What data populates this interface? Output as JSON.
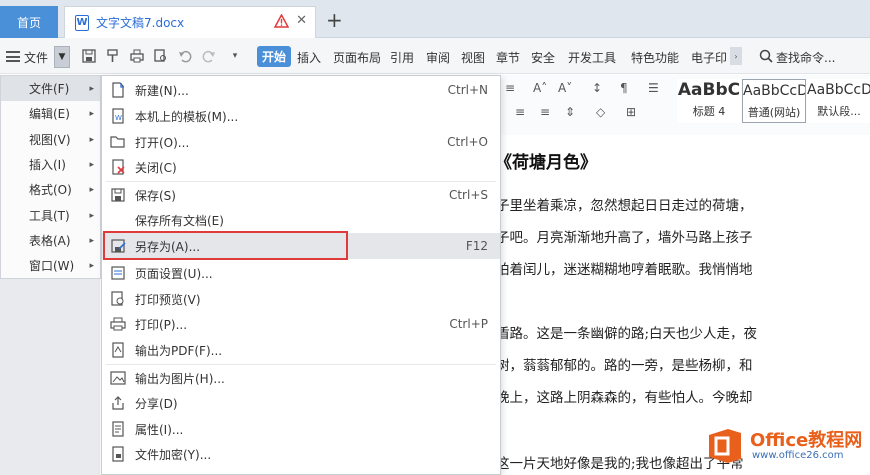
{
  "tabbar": {
    "home_tab": "首页",
    "doc_tab_title": "文字文稿7.docx",
    "doc_icon_letter": "W",
    "close_glyph": "✕",
    "add_glyph": "+"
  },
  "toolbar": {
    "file_menu_label": "文件",
    "ribbon_tabs": [
      "开始",
      "插入",
      "页面布局",
      "引用",
      "审阅",
      "视图",
      "章节",
      "安全",
      "开发工具",
      "特色功能",
      "电子印"
    ],
    "search_label": "查找命令..."
  },
  "styles": [
    {
      "sample": "AaBbC",
      "name": "标题 4"
    },
    {
      "sample": "AaBbCcDd",
      "name": "普通(网站)"
    },
    {
      "sample": "AaBbCcDd",
      "name": "默认段..."
    }
  ],
  "main_menu": [
    {
      "label": "文件(F)"
    },
    {
      "label": "编辑(E)"
    },
    {
      "label": "视图(V)"
    },
    {
      "label": "插入(I)"
    },
    {
      "label": "格式(O)"
    },
    {
      "label": "工具(T)"
    },
    {
      "label": "表格(A)"
    },
    {
      "label": "窗口(W)"
    }
  ],
  "file_submenu": [
    {
      "label": "新建(N)...",
      "shortcut": "Ctrl+N",
      "icon": "new-doc-icon"
    },
    {
      "label": "本机上的模板(M)...",
      "shortcut": "",
      "icon": "template-icon"
    },
    {
      "label": "打开(O)...",
      "shortcut": "Ctrl+O",
      "icon": "folder-open-icon"
    },
    {
      "label": "关闭(C)",
      "shortcut": "",
      "icon": "close-doc-icon"
    },
    {
      "label": "保存(S)",
      "shortcut": "Ctrl+S",
      "icon": "save-icon"
    },
    {
      "label": "保存所有文档(E)",
      "shortcut": "",
      "icon": ""
    },
    {
      "label": "另存为(A)...",
      "shortcut": "F12",
      "icon": "save-as-icon"
    },
    {
      "label": "页面设置(U)...",
      "shortcut": "",
      "icon": "page-setup-icon"
    },
    {
      "label": "打印预览(V)",
      "shortcut": "",
      "icon": "print-preview-icon"
    },
    {
      "label": "打印(P)...",
      "shortcut": "Ctrl+P",
      "icon": "print-icon"
    },
    {
      "label": "输出为PDF(F)...",
      "shortcut": "",
      "icon": "pdf-icon"
    },
    {
      "label": "输出为图片(H)...",
      "shortcut": "",
      "icon": "image-export-icon"
    },
    {
      "label": "分享(D)",
      "shortcut": "",
      "icon": "share-icon"
    },
    {
      "label": "属性(I)...",
      "shortcut": "",
      "icon": "properties-icon"
    },
    {
      "label": "文件加密(Y)...",
      "shortcut": "",
      "icon": "encrypt-icon"
    }
  ],
  "document": {
    "title": "《荷塘月色》",
    "lines": [
      "子里坐着乘凉，忽然想起日日走过的荷塘，",
      "子吧。月亮渐渐地升高了，墙外马路上孩子",
      "拍着闰儿，迷迷糊糊地哼着眠歌。我悄悄地",
      "",
      "盾路。这是一条幽僻的路;白天也少人走，夜",
      "树，蓊蓊郁郁的。路的一旁，是些杨柳，和",
      "晚上，这路上阴森森的，有些怕人。今晚却",
      "",
      "这一片天地好像是我的;我也像超出了平常"
    ]
  },
  "logo": {
    "name": "Office教程网",
    "url": "www.office26.com"
  },
  "colors": {
    "accent": "#4a90d9",
    "highlight_box": "#e03a3a",
    "logo_orange": "#e8601c"
  }
}
